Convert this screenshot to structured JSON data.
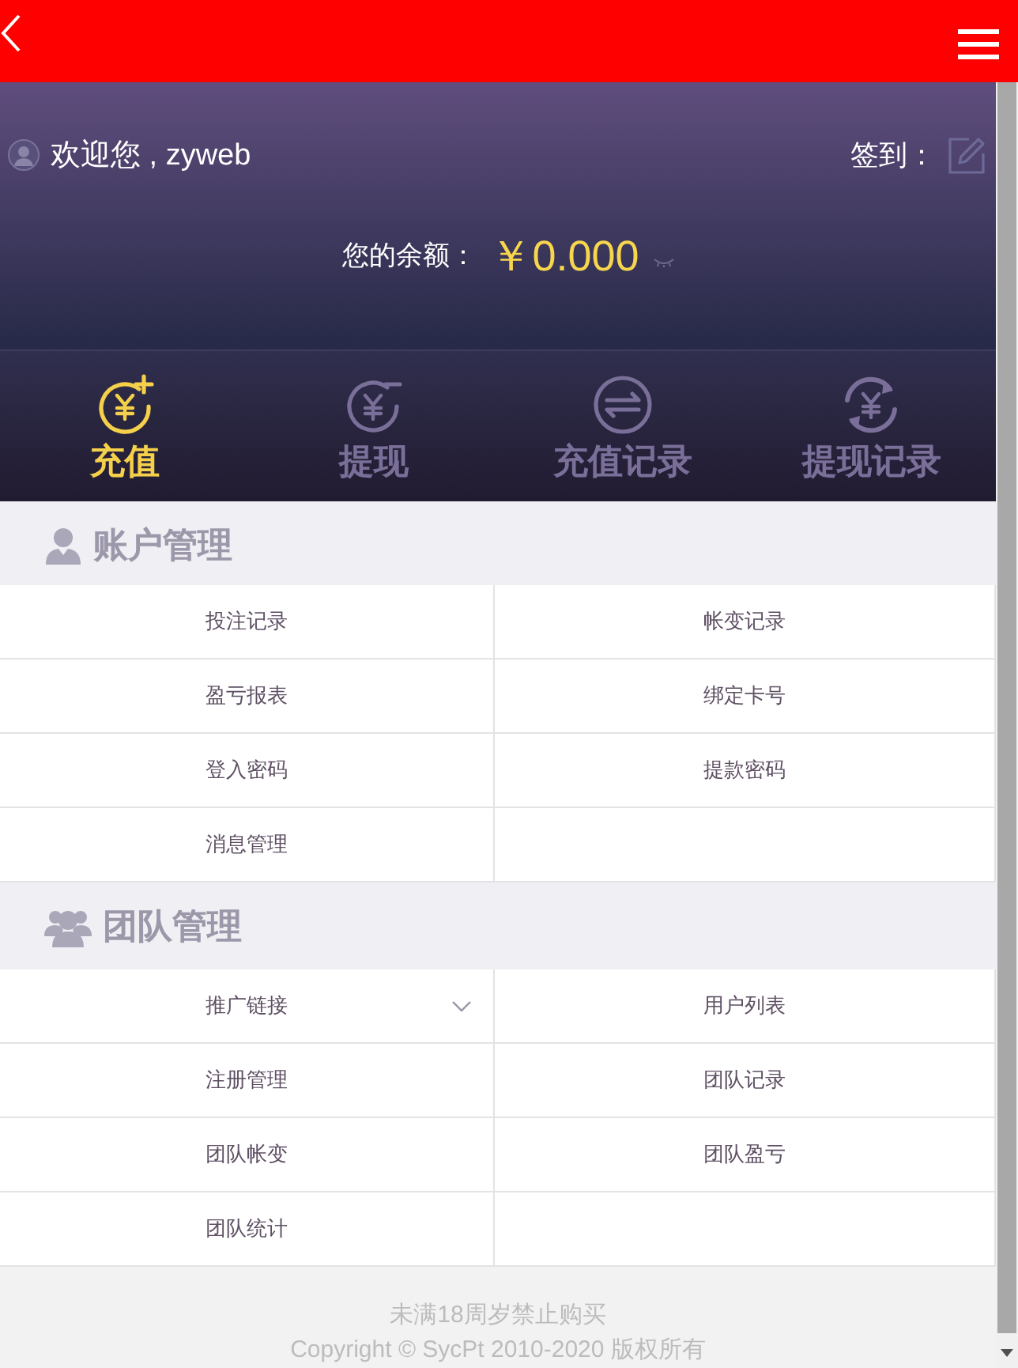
{
  "profile": {
    "greeting": "欢迎您 , zyweb",
    "checkin_label": "签到：",
    "balance_label": "您的余额：",
    "balance": "￥0.000"
  },
  "actions": [
    {
      "label": "充值",
      "kind": "deposit",
      "selected": true
    },
    {
      "label": "提现",
      "kind": "withdraw",
      "selected": false
    },
    {
      "label": "充值记录",
      "kind": "deposit_record",
      "selected": false
    },
    {
      "label": "提现记录",
      "kind": "withdraw_record",
      "selected": false
    }
  ],
  "sections": [
    {
      "title": "账户管理",
      "kind": "account",
      "items": [
        {
          "label": "投注记录",
          "kind": "link"
        },
        {
          "label": "帐变记录",
          "kind": "link"
        },
        {
          "label": "盈亏报表",
          "kind": "link"
        },
        {
          "label": "绑定卡号",
          "kind": "link"
        },
        {
          "label": "登入密码",
          "kind": "link"
        },
        {
          "label": "提款密码",
          "kind": "link"
        },
        {
          "label": "消息管理",
          "kind": "link"
        }
      ]
    },
    {
      "title": "团队管理",
      "kind": "team",
      "items": [
        {
          "label": "推广链接",
          "kind": "dropdown"
        },
        {
          "label": "用户列表",
          "kind": "link"
        },
        {
          "label": "注册管理",
          "kind": "link"
        },
        {
          "label": "团队记录",
          "kind": "link"
        },
        {
          "label": "团队帐变",
          "kind": "link"
        },
        {
          "label": "团队盈亏",
          "kind": "link"
        },
        {
          "label": "团队统计",
          "kind": "link"
        }
      ]
    }
  ],
  "footer": {
    "notice": "未满18周岁禁止购买",
    "copyright": "Copyright © SycPt 2010-2020 版权所有"
  }
}
